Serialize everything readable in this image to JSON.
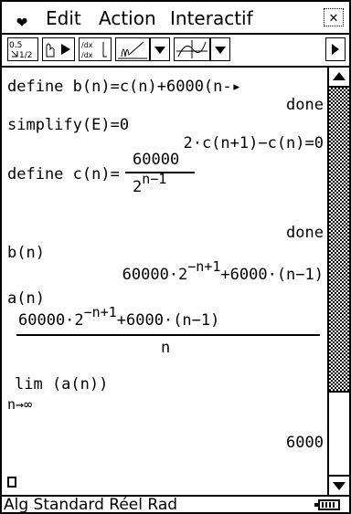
{
  "menu": {
    "arrow": "❤",
    "items": [
      "Edit",
      "Action",
      "Interactif"
    ],
    "close": "✕"
  },
  "toolbar": {
    "icons": [
      "fraction-decimal-icon",
      "stop-play-icon",
      "derivative-icon",
      "integral-icon",
      "graph-icon"
    ],
    "fraction_top": "0.5",
    "fraction_bottom": "1/2"
  },
  "work": {
    "line1": "define b(n)=c(n)+6000(n-▸",
    "done1": "done",
    "line2": "simplify(E)=0",
    "line3": "2·c(n+1)−c(n)=0",
    "line4_prefix": "define c(n)=",
    "c_num": "60000",
    "c_den_base": "2",
    "c_den_exp": "n−1",
    "done2": "done",
    "line5": "b(n)",
    "b_expr_part1": "60000·2",
    "b_expr_exp": "−n+1",
    "b_expr_part2": "+6000·(n−1)",
    "line6": "a(n)",
    "a_num_part1": "60000·2",
    "a_num_exp": "−n+1",
    "a_num_part2": "+6000·(n−1)",
    "a_den": "n",
    "lim_text": "lim (a(n))",
    "lim_sub": "n→∞",
    "result": "6000"
  },
  "status": {
    "text": "Alg    Standard Réel Rad"
  }
}
